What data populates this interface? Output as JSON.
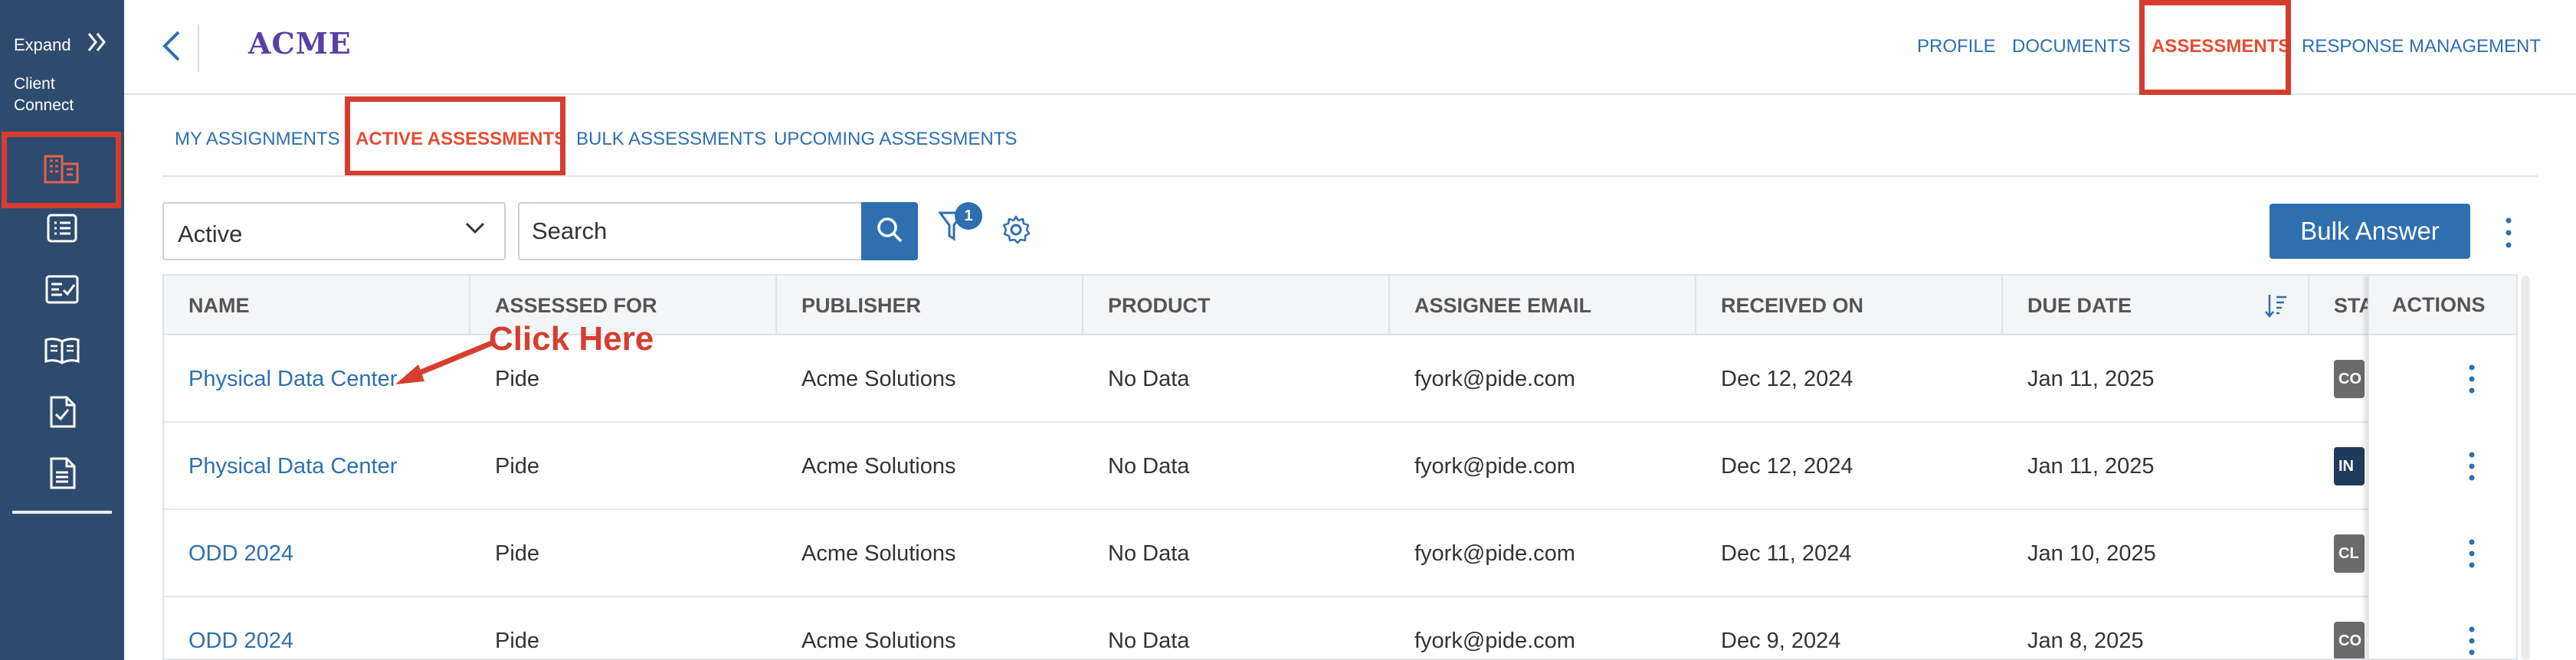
{
  "sidebar": {
    "expand_label": "Expand",
    "client_label": "Client Connect",
    "icons": [
      "building-icon",
      "list-icon",
      "checklist-icon",
      "book-icon",
      "checked-document-icon",
      "document-icon"
    ],
    "active_index": 0
  },
  "header": {
    "logo": "ACME",
    "nav": [
      "PROFILE",
      "DOCUMENTS",
      "ASSESSMENTS",
      "RESPONSE MANAGEMENT"
    ],
    "active_nav": "ASSESSMENTS"
  },
  "subtabs": {
    "items": [
      "MY ASSIGNMENTS",
      "ACTIVE ASSESSMENTS",
      "BULK ASSESSMENTS",
      "UPCOMING ASSESSMENTS"
    ],
    "active": "ACTIVE ASSESSMENTS"
  },
  "toolbar": {
    "status_value": "Active",
    "search_placeholder": "Search",
    "filter_count": "1",
    "bulk_label": "Bulk Answer"
  },
  "table": {
    "columns": [
      "NAME",
      "ASSESSED FOR",
      "PUBLISHER",
      "PRODUCT",
      "ASSIGNEE EMAIL",
      "RECEIVED ON",
      "DUE DATE",
      "STA",
      "ACTIONS"
    ],
    "rows": [
      {
        "name": "Physical Data Center",
        "assessed_for": "Pide",
        "publisher": "Acme Solutions",
        "product": "No Data",
        "email": "fyork@pide.com",
        "received": "Dec 12, 2024",
        "due": "Jan 11, 2025",
        "status": "CO",
        "status_color": "#6b6b6b"
      },
      {
        "name": "Physical Data Center",
        "assessed_for": "Pide",
        "publisher": "Acme Solutions",
        "product": "No Data",
        "email": "fyork@pide.com",
        "received": "Dec 12, 2024",
        "due": "Jan 11, 2025",
        "status": "IN",
        "status_color": "#1f3b5c"
      },
      {
        "name": "ODD 2024",
        "assessed_for": "Pide",
        "publisher": "Acme Solutions",
        "product": "No Data",
        "email": "fyork@pide.com",
        "received": "Dec 11, 2024",
        "due": "Jan 10, 2025",
        "status": "CL",
        "status_color": "#6b6b6b"
      },
      {
        "name": "ODD 2024",
        "assessed_for": "Pide",
        "publisher": "Acme Solutions",
        "product": "No Data",
        "email": "fyork@pide.com",
        "received": "Dec 9, 2024",
        "due": "Jan 8, 2025",
        "status": "CO",
        "status_color": "#6b6b6b"
      }
    ]
  },
  "annotation": {
    "text": "Click Here"
  },
  "colors": {
    "sidebar": "#2d4b6e",
    "accent": "#2e6fb0",
    "active_red": "#e44d32",
    "highlight_box": "#d63d2f"
  }
}
